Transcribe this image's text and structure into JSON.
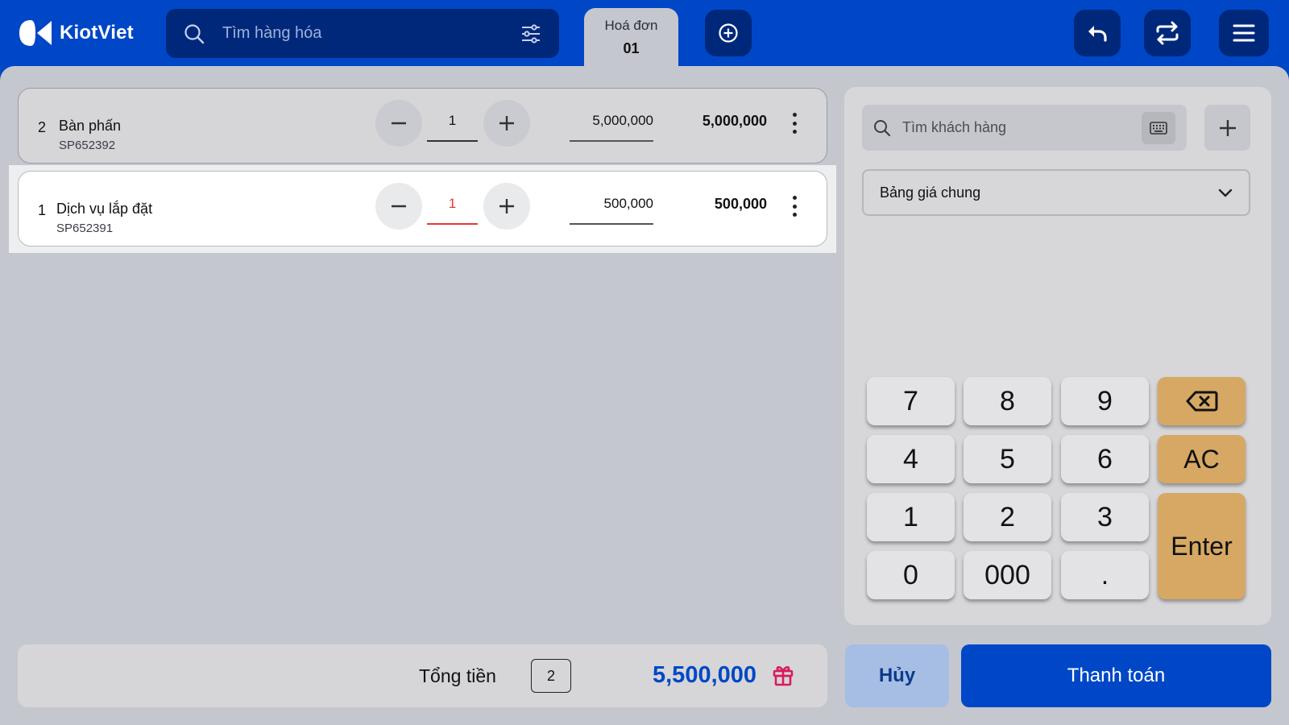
{
  "app": {
    "name": "KiotViet"
  },
  "colors": {
    "brand": "#0047c7",
    "dark_brand": "#00287a",
    "accent_orange": "#d6a864",
    "error_red": "#e53935"
  },
  "search": {
    "placeholder": "Tìm hàng hóa"
  },
  "tab": {
    "title": "Hoá đơn",
    "number": "01"
  },
  "cart": {
    "items": [
      {
        "index": "2",
        "name": "Bàn phấn",
        "code": "SP652392",
        "qty": "1",
        "price": "5,000,000",
        "total": "5,000,000"
      },
      {
        "index": "1",
        "name": "Dịch vụ lắp đặt",
        "code": "SP652391",
        "qty": "1",
        "price": "500,000",
        "total": "500,000"
      }
    ]
  },
  "customer": {
    "placeholder": "Tìm khách hàng"
  },
  "pricebook": {
    "selected": "Bảng giá chung"
  },
  "keypad": {
    "k7": "7",
    "k8": "8",
    "k9": "9",
    "k4": "4",
    "k5": "5",
    "k6": "6",
    "ac": "AC",
    "k1": "1",
    "k2": "2",
    "k3": "3",
    "enter": "Enter",
    "k0": "0",
    "k000": "000",
    "dot": "."
  },
  "footer": {
    "total_label": "Tổng tiền",
    "count": "2",
    "amount": "5,500,000",
    "cancel": "Hủy",
    "pay": "Thanh toán"
  }
}
